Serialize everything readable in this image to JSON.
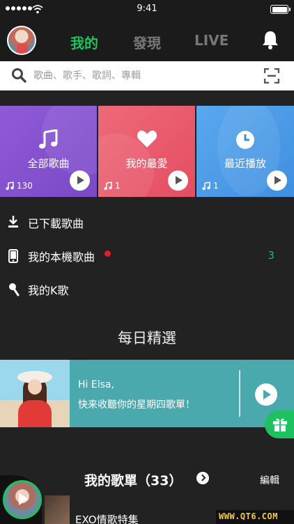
{
  "status_bar": {
    "time": "9:41"
  },
  "header": {
    "tabs": [
      {
        "label": "我的",
        "active": true
      },
      {
        "label": "發現",
        "active": false
      },
      {
        "label": "LIVE",
        "active": false
      }
    ]
  },
  "search": {
    "placeholder": "歌曲、歌手、歌詞、專輯"
  },
  "tiles": [
    {
      "label": "全部歌曲",
      "count": "130",
      "icon": "music-note-icon",
      "color": "#8f5ad8"
    },
    {
      "label": "我的最愛",
      "count": "1",
      "icon": "heart-icon",
      "color": "#e44d63"
    },
    {
      "label": "最近播放",
      "count": "1",
      "icon": "clock-icon",
      "color": "#3f8fe0"
    }
  ],
  "library": [
    {
      "label": "已下載歌曲",
      "icon": "download-icon"
    },
    {
      "label": "我的本機歌曲",
      "icon": "phone-icon",
      "count": "3"
    },
    {
      "label": "我的K歌",
      "icon": "microphone-icon"
    }
  ],
  "daily": {
    "title": "每日精選",
    "greeting": "Hi Elsa,",
    "message": "快来收聽你的星期四歌單！"
  },
  "playlists": {
    "title": "我的歌單（33）",
    "edit_label": "編輯",
    "items": [
      {
        "name": "EXO情歌特集"
      }
    ]
  },
  "watermark": "WWW.QT6.COM",
  "colors": {
    "accent": "#1ec15f",
    "background": "#222222",
    "banner": "#4aa9ad"
  }
}
